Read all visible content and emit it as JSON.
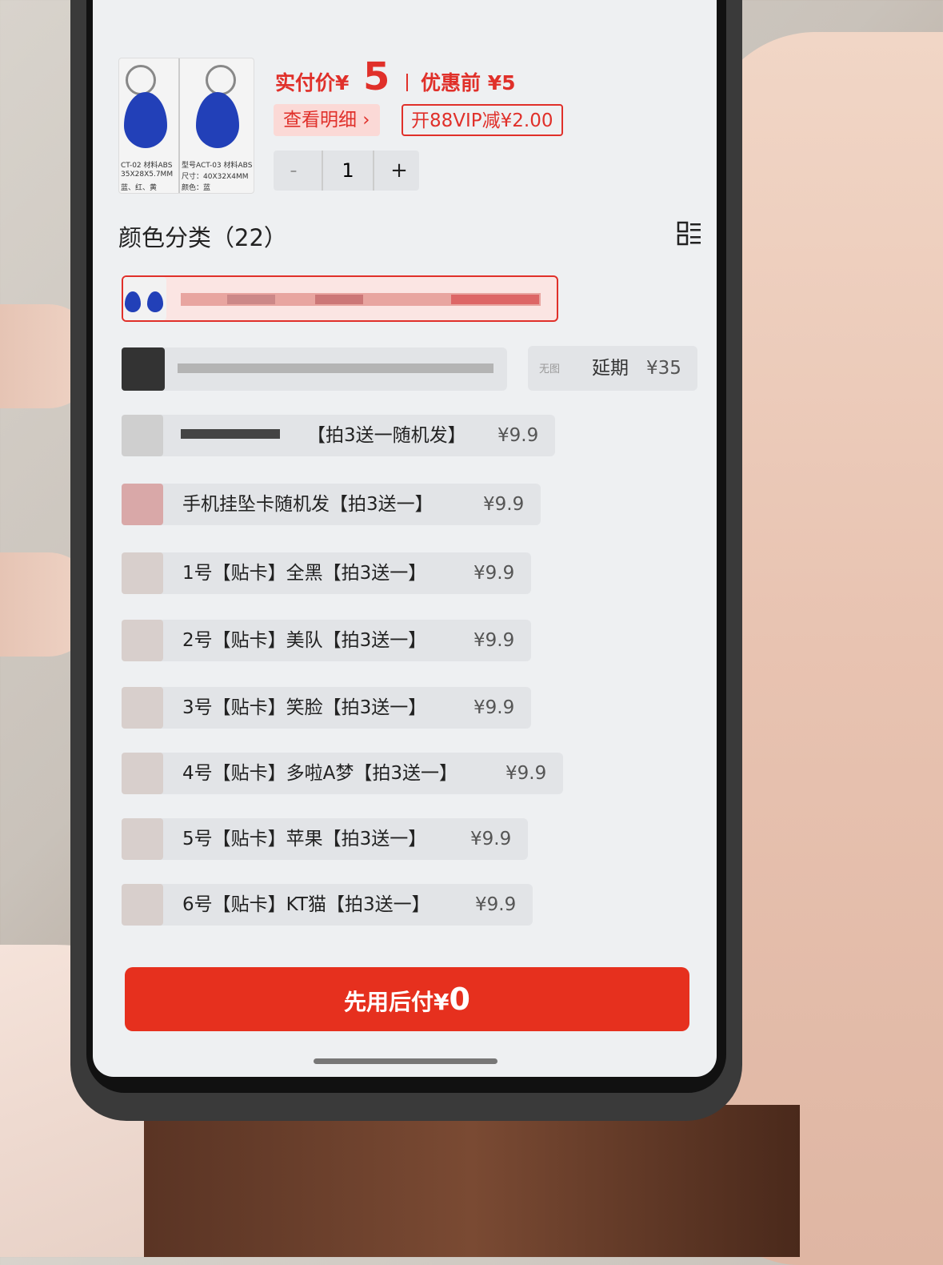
{
  "header": {
    "actual_price_label": "实付价¥",
    "actual_price_value": "5",
    "original_price_label": "优惠前 ¥5",
    "detail_button": "查看明细 ›",
    "vip_button": "开88VIP减¥2.00",
    "quantity": "1",
    "minus": "-",
    "plus": "+",
    "thumb_caption_1": "CT-02 材料ABS",
    "thumb_caption_2": "35X28X5.7MM",
    "thumb_caption_3": "蓝、红、黄",
    "thumb_caption_4": "型号ACT-03 材料ABS",
    "thumb_caption_5": "尺寸：40X32X4MM",
    "thumb_caption_6": "颜色：蓝"
  },
  "section": {
    "title": "颜色分类（22）"
  },
  "nopic": {
    "badge": "无图",
    "label": "延期",
    "price": "¥35"
  },
  "items": [
    {
      "text": "【拍3送一随机发】",
      "price": "¥9.9"
    },
    {
      "text": "手机挂坠卡随机发【拍3送一】",
      "price": "¥9.9"
    },
    {
      "text": "1号【贴卡】全黑【拍3送一】",
      "price": "¥9.9"
    },
    {
      "text": "2号【贴卡】美队【拍3送一】",
      "price": "¥9.9"
    },
    {
      "text": "3号【贴卡】笑脸【拍3送一】",
      "price": "¥9.9"
    },
    {
      "text": "4号【贴卡】多啦A梦【拍3送一】",
      "price": "¥9.9"
    },
    {
      "text": "5号【贴卡】苹果【拍3送一】",
      "price": "¥9.9"
    },
    {
      "text": "6号【贴卡】KT猫【拍3送一】",
      "price": "¥9.9"
    }
  ],
  "pay_button": {
    "label": "先用后付¥",
    "amount": "0"
  },
  "colors": {
    "accent": "#e0302a",
    "pay_button": "#e6301e",
    "chip_bg": "#e2e4e7"
  }
}
